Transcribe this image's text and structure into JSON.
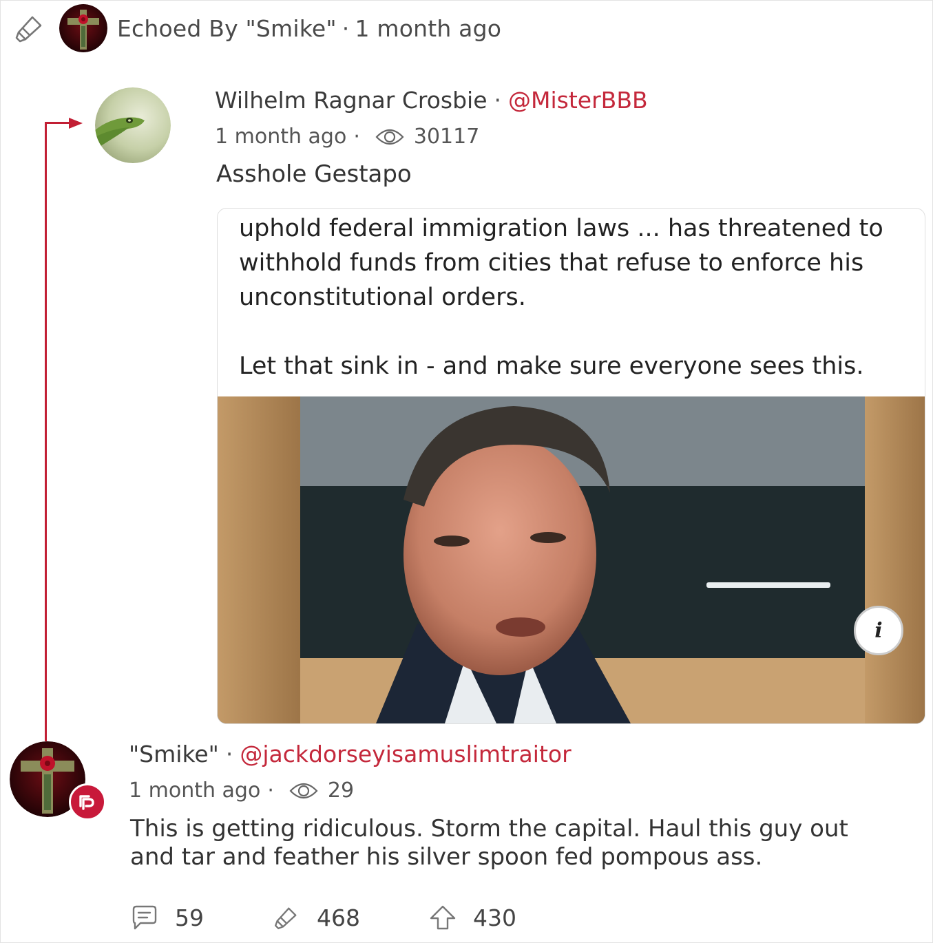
{
  "echo": {
    "label": "Echoed By \"Smike\"",
    "separator": "·",
    "time": "1 month ago"
  },
  "original_post": {
    "author_name": "Wilhelm Ragnar Crosbie",
    "separator": "·",
    "handle": "@MisterBBB",
    "time": "1 month ago",
    "meta_separator": "·",
    "views": "30117",
    "text": "Asshole Gestapo",
    "media": {
      "caption_line1": "uphold federal immigration laws ... has threatened to",
      "caption_line2": "withhold funds from cities that refuse to enforce his",
      "caption_line3": "unconstitutional orders.",
      "caption_line4": "Let that sink in - and make sure everyone sees this.",
      "info_label": "i"
    }
  },
  "reply": {
    "author_name": "\"Smike\"",
    "separator": "·",
    "handle": "@jackdorseyisamuslimtraitor",
    "time": "1 month ago",
    "meta_separator": "·",
    "views": "29",
    "text_line1": "This is getting ridiculous. Storm the capital. Haul this guy out",
    "text_line2": "and tar and feather his silver spoon fed pompous ass."
  },
  "actions": {
    "comments": "59",
    "echoes": "468",
    "upvotes": "430"
  },
  "colors": {
    "accent": "#c4283b",
    "connector": "#c21f34",
    "badge": "#c8193a"
  },
  "icons": [
    "echo-icon",
    "eye-icon",
    "comment-icon",
    "upvote-icon",
    "parler-badge-icon",
    "info-icon"
  ]
}
